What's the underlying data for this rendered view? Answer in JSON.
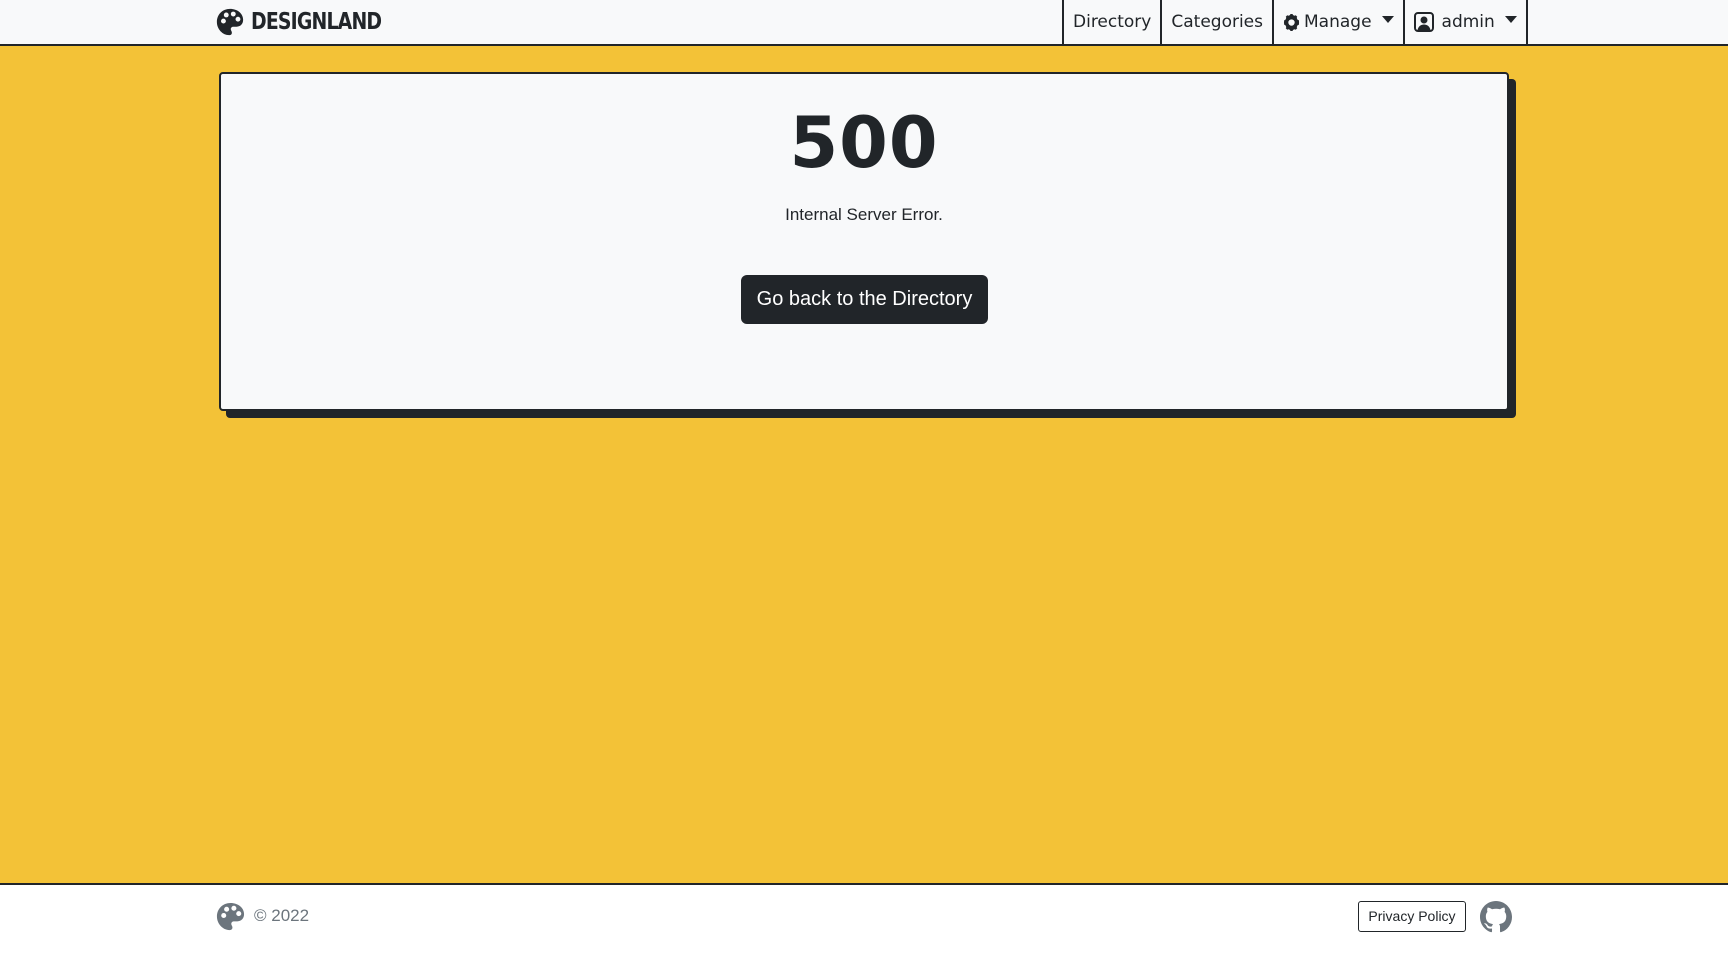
{
  "navbar": {
    "brand": "DESIGNLAND",
    "brand_icon": "palette-icon",
    "items": [
      {
        "label": "Directory"
      },
      {
        "label": "Categories"
      },
      {
        "label": "Manage",
        "icon": "gear-icon"
      },
      {
        "label": "admin",
        "icon": "user-icon"
      }
    ]
  },
  "error": {
    "code": "500",
    "message": "Internal Server Error.",
    "button_label": "Go back to the Directory"
  },
  "footer": {
    "copyright": "© 2022",
    "privacy_label": "Privacy Policy",
    "github_icon": "github-icon"
  },
  "colors": {
    "background": "#f3c237",
    "dark": "#212529",
    "card": "#f8f9fa"
  }
}
